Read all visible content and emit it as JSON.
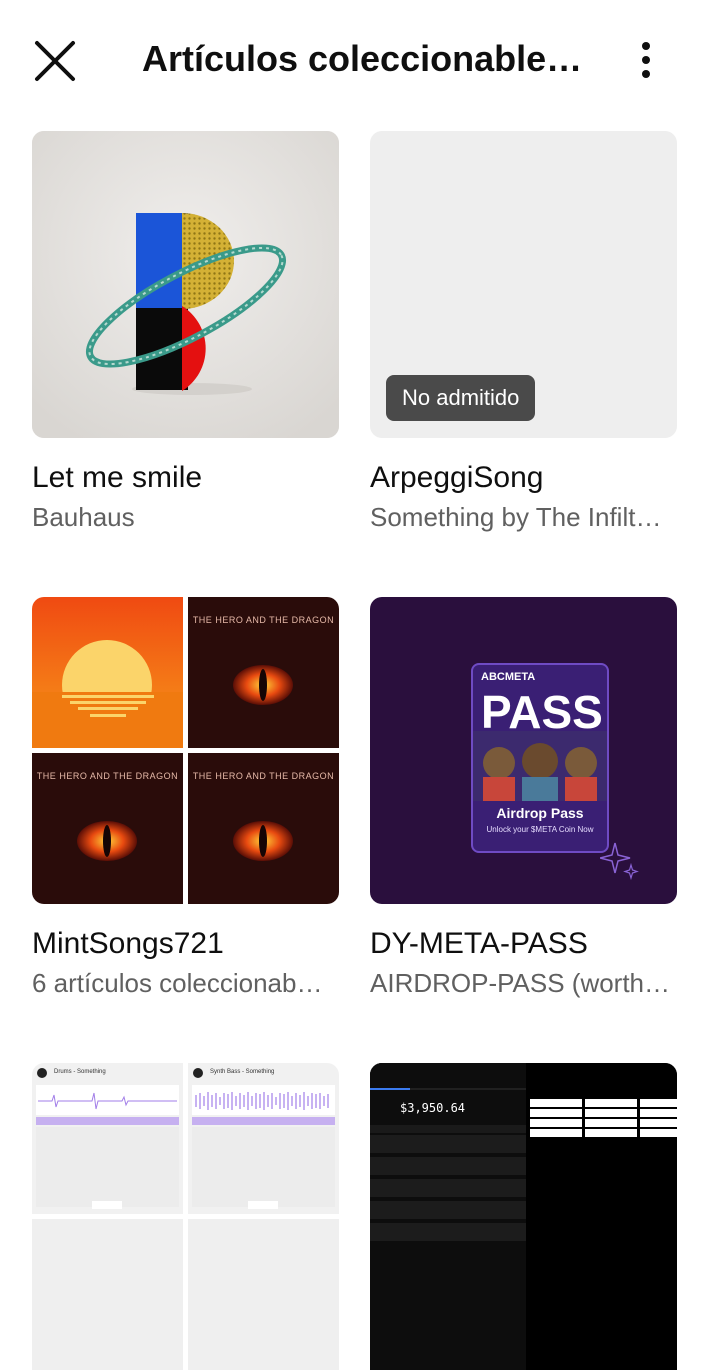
{
  "header": {
    "title": "Artículos coleccionable…",
    "close_icon": "close-icon",
    "more_icon": "more-vert-icon"
  },
  "items": [
    {
      "title": "Let me smile",
      "subtitle": "Bauhaus"
    },
    {
      "title": "ArpeggiSong",
      "subtitle": "Something by The Infilt…",
      "badge": "No admitido"
    },
    {
      "title": "MintSongs721",
      "subtitle": "6 artículos coleccionab…",
      "tile_text": "THE HERO AND THE DRAGON"
    },
    {
      "title": "DY-META-PASS",
      "subtitle": "AIRDROP-PASS (worth …",
      "pass": {
        "brand": "ABCMETA",
        "big": "PASS",
        "caption": "Airdrop Pass",
        "tagline": "Unlock your $META Coin Now"
      }
    },
    {
      "audio": {
        "left_title": "Drums - Something",
        "right_title": "Synth Bass - Something"
      }
    },
    {
      "wallet": {
        "balance": "$3,950.64"
      }
    }
  ]
}
